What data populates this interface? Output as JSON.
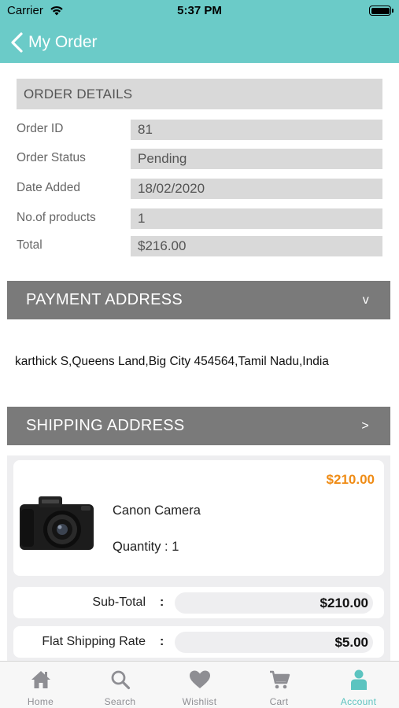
{
  "status_bar": {
    "carrier": "Carrier",
    "time": "5:37 PM"
  },
  "navbar": {
    "title": "My Order"
  },
  "order_details": {
    "header": "ORDER DETAILS",
    "rows": [
      {
        "label": "Order ID",
        "value": "81"
      },
      {
        "label": "Order Status",
        "value": "Pending"
      },
      {
        "label": "Date Added",
        "value": "18/02/2020"
      },
      {
        "label": "No.of products",
        "value": "1"
      },
      {
        "label": "Total",
        "value": "$216.00"
      }
    ]
  },
  "payment_address": {
    "header": "PAYMENT ADDRESS",
    "chevron": "v",
    "text": "karthick S,Queens Land,Big City 454564,Tamil Nadu,India"
  },
  "shipping_address": {
    "header": "SHIPPING ADDRESS",
    "chevron": ">"
  },
  "product": {
    "price": "$210.00",
    "name": "Canon Camera",
    "quantity": "Quantity : 1",
    "image_icon": "camera-image"
  },
  "summary": [
    {
      "label": "Sub-Total",
      "colon": ":",
      "amount": "$210.00"
    },
    {
      "label": "Flat Shipping Rate",
      "colon": ":",
      "amount": "$5.00"
    }
  ],
  "tabs": [
    {
      "label": "Home",
      "icon": "home-icon"
    },
    {
      "label": "Search",
      "icon": "search-icon"
    },
    {
      "label": "Wishlist",
      "icon": "heart-icon"
    },
    {
      "label": "Cart",
      "icon": "cart-icon"
    },
    {
      "label": "Account",
      "icon": "account-icon",
      "active": true
    }
  ],
  "colors": {
    "accent": "#6bcbc8",
    "price": "#ef8c16",
    "dark_header": "#7a7a7a",
    "light_field": "#d9d9d9",
    "active_tab": "#5cc4c0"
  }
}
